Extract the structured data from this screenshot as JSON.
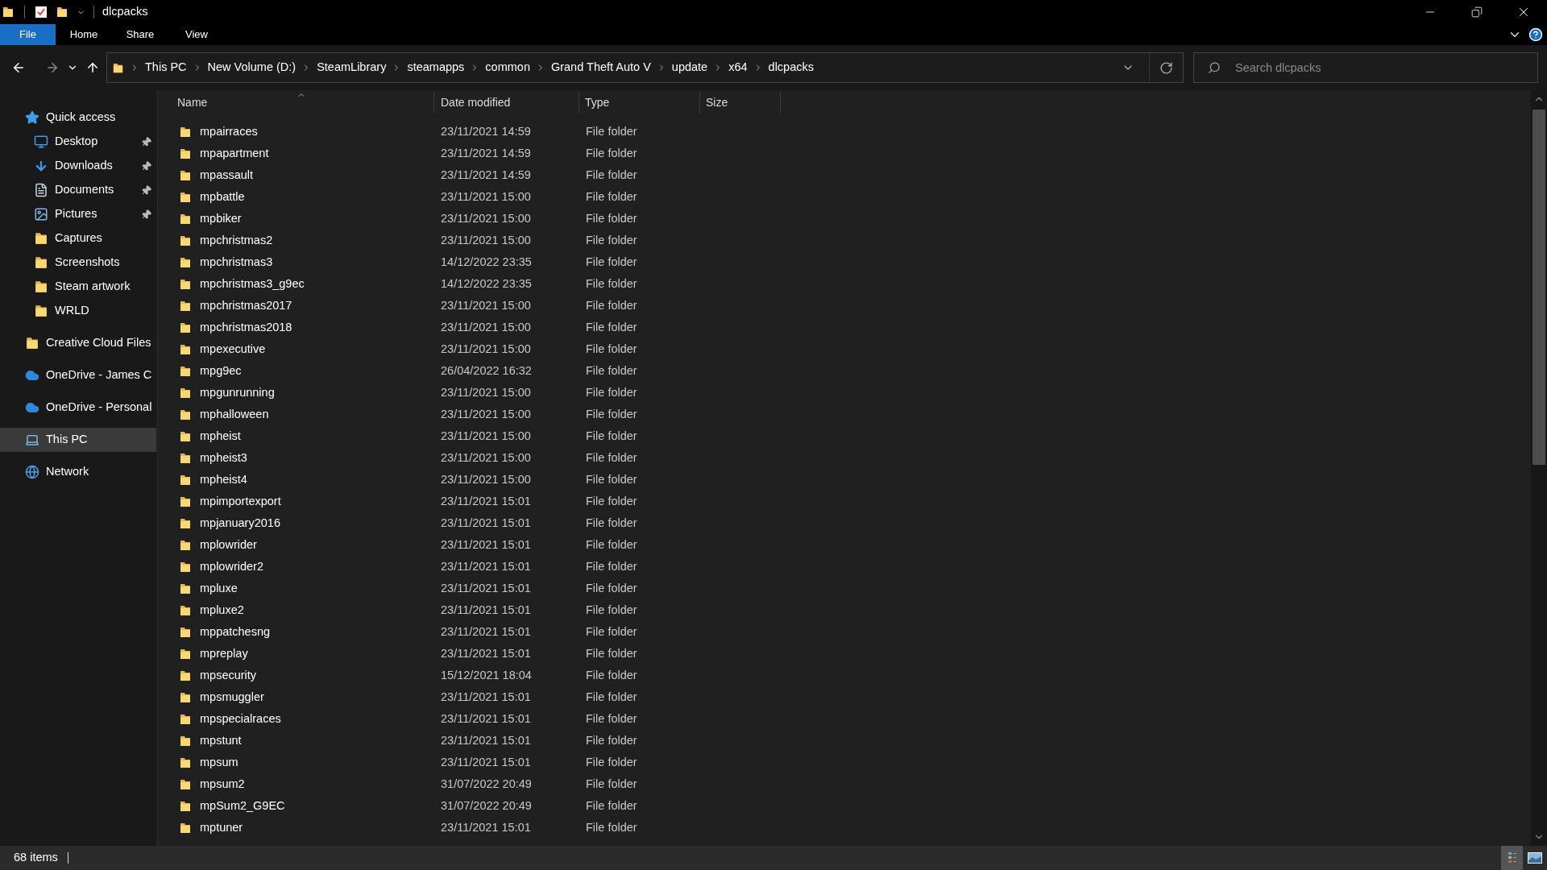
{
  "window": {
    "title": "dlcpacks"
  },
  "ribbon_tabs": [
    {
      "label": "File",
      "selected": true
    },
    {
      "label": "Home",
      "selected": false
    },
    {
      "label": "Share",
      "selected": false
    },
    {
      "label": "View",
      "selected": false
    }
  ],
  "breadcrumb": [
    "This PC",
    "New Volume (D:)",
    "SteamLibrary",
    "steamapps",
    "common",
    "Grand Theft Auto V",
    "update",
    "x64",
    "dlcpacks"
  ],
  "search": {
    "placeholder": "Search dlcpacks"
  },
  "sidebar": {
    "items": [
      {
        "label": "Quick access",
        "kind": "star",
        "selected": false,
        "children": [
          {
            "label": "Desktop",
            "kind": "desktop",
            "pinned": true,
            "selected": false
          },
          {
            "label": "Downloads",
            "kind": "download",
            "pinned": true,
            "selected": false
          },
          {
            "label": "Documents",
            "kind": "document",
            "pinned": true,
            "selected": false
          },
          {
            "label": "Pictures",
            "kind": "picture",
            "pinned": true,
            "selected": false
          },
          {
            "label": "Captures",
            "kind": "folder",
            "pinned": false,
            "selected": false
          },
          {
            "label": "Screenshots",
            "kind": "folder",
            "pinned": false,
            "selected": false
          },
          {
            "label": "Steam artwork",
            "kind": "folder",
            "pinned": false,
            "selected": false
          },
          {
            "label": "WRLD",
            "kind": "folder",
            "pinned": false,
            "selected": false
          }
        ]
      },
      {
        "label": "Creative Cloud Files",
        "kind": "cloudfolder",
        "selected": false
      },
      {
        "label": "OneDrive - James C",
        "kind": "cloud",
        "selected": false
      },
      {
        "label": "OneDrive - Personal",
        "kind": "cloud",
        "selected": false
      },
      {
        "label": "This PC",
        "kind": "pc",
        "selected": true
      },
      {
        "label": "Network",
        "kind": "network",
        "selected": false
      }
    ]
  },
  "table": {
    "columns": [
      "Name",
      "Date modified",
      "Type",
      "Size"
    ],
    "rows": [
      [
        "mpairraces",
        "23/11/2021 14:59",
        "File folder"
      ],
      [
        "mpapartment",
        "23/11/2021 14:59",
        "File folder"
      ],
      [
        "mpassault",
        "23/11/2021 14:59",
        "File folder"
      ],
      [
        "mpbattle",
        "23/11/2021 15:00",
        "File folder"
      ],
      [
        "mpbiker",
        "23/11/2021 15:00",
        "File folder"
      ],
      [
        "mpchristmas2",
        "23/11/2021 15:00",
        "File folder"
      ],
      [
        "mpchristmas3",
        "14/12/2022 23:35",
        "File folder"
      ],
      [
        "mpchristmas3_g9ec",
        "14/12/2022 23:35",
        "File folder"
      ],
      [
        "mpchristmas2017",
        "23/11/2021 15:00",
        "File folder"
      ],
      [
        "mpchristmas2018",
        "23/11/2021 15:00",
        "File folder"
      ],
      [
        "mpexecutive",
        "23/11/2021 15:00",
        "File folder"
      ],
      [
        "mpg9ec",
        "26/04/2022 16:32",
        "File folder"
      ],
      [
        "mpgunrunning",
        "23/11/2021 15:00",
        "File folder"
      ],
      [
        "mphalloween",
        "23/11/2021 15:00",
        "File folder"
      ],
      [
        "mpheist",
        "23/11/2021 15:00",
        "File folder"
      ],
      [
        "mpheist3",
        "23/11/2021 15:00",
        "File folder"
      ],
      [
        "mpheist4",
        "23/11/2021 15:00",
        "File folder"
      ],
      [
        "mpimportexport",
        "23/11/2021 15:01",
        "File folder"
      ],
      [
        "mpjanuary2016",
        "23/11/2021 15:01",
        "File folder"
      ],
      [
        "mplowrider",
        "23/11/2021 15:01",
        "File folder"
      ],
      [
        "mplowrider2",
        "23/11/2021 15:01",
        "File folder"
      ],
      [
        "mpluxe",
        "23/11/2021 15:01",
        "File folder"
      ],
      [
        "mpluxe2",
        "23/11/2021 15:01",
        "File folder"
      ],
      [
        "mppatchesng",
        "23/11/2021 15:01",
        "File folder"
      ],
      [
        "mpreplay",
        "23/11/2021 15:01",
        "File folder"
      ],
      [
        "mpsecurity",
        "15/12/2021 18:04",
        "File folder"
      ],
      [
        "mpsmuggler",
        "23/11/2021 15:01",
        "File folder"
      ],
      [
        "mpspecialraces",
        "23/11/2021 15:01",
        "File folder"
      ],
      [
        "mpstunt",
        "23/11/2021 15:01",
        "File folder"
      ],
      [
        "mpsum",
        "23/11/2021 15:01",
        "File folder"
      ],
      [
        "mpsum2",
        "31/07/2022 20:49",
        "File folder"
      ],
      [
        "mpSum2_G9EC",
        "31/07/2022 20:49",
        "File folder"
      ],
      [
        "mptuner",
        "23/11/2021 15:01",
        "File folder"
      ]
    ]
  },
  "status_bar": {
    "count": "68 items"
  }
}
